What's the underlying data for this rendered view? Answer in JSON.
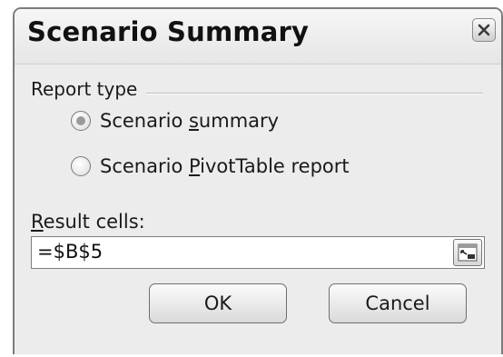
{
  "dialog": {
    "title": "Scenario Summary",
    "close_icon": "close-icon"
  },
  "report_type": {
    "label": "Report type",
    "options": [
      {
        "label_before": "Scenario ",
        "accel": "s",
        "label_after": "ummary",
        "checked": true
      },
      {
        "label_before": "Scenario ",
        "accel": "P",
        "label_after": "ivotTable report",
        "checked": false
      }
    ]
  },
  "result_cells": {
    "label_accel": "R",
    "label_rest": "esult cells:",
    "value": "=$B$5",
    "collapse_icon": "collapse-dialog-icon"
  },
  "buttons": {
    "ok": "OK",
    "cancel": "Cancel"
  }
}
